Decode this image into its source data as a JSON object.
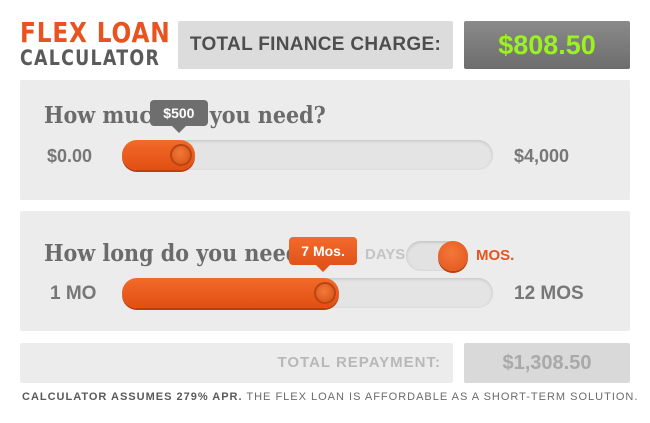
{
  "logo": {
    "line1": "FLEX LOAN",
    "line2": "CALCULATOR"
  },
  "header": {
    "finance_charge_label": "TOTAL FINANCE CHARGE:",
    "finance_charge_value": "$808.50"
  },
  "amount": {
    "question": "How much do you need?",
    "min_label": "$0.00",
    "max_label": "$4,000",
    "tooltip": "$500",
    "value": 500,
    "min": 0,
    "max": 4000
  },
  "duration": {
    "question": "How long do you need",
    "toggle_left_label": "DAYS",
    "toggle_right_label": "MOS.",
    "toggle_state": "MOS.",
    "min_label": "1 MO",
    "max_label": "12 MOS",
    "tooltip": "7 Mos.",
    "value": 7,
    "min": 1,
    "max": 12
  },
  "repayment": {
    "label": "TOTAL REPAYMENT:",
    "value": "$1,308.50"
  },
  "footnote": {
    "bold_part": "CALCULATOR ASSUMES 279% APR.",
    "rest": " THE FLEX LOAN IS AFFORDABLE AS A SHORT-TERM SOLUTION."
  },
  "colors": {
    "accent_orange": "#e8531f",
    "finance_value_green": "#9cf21e"
  }
}
